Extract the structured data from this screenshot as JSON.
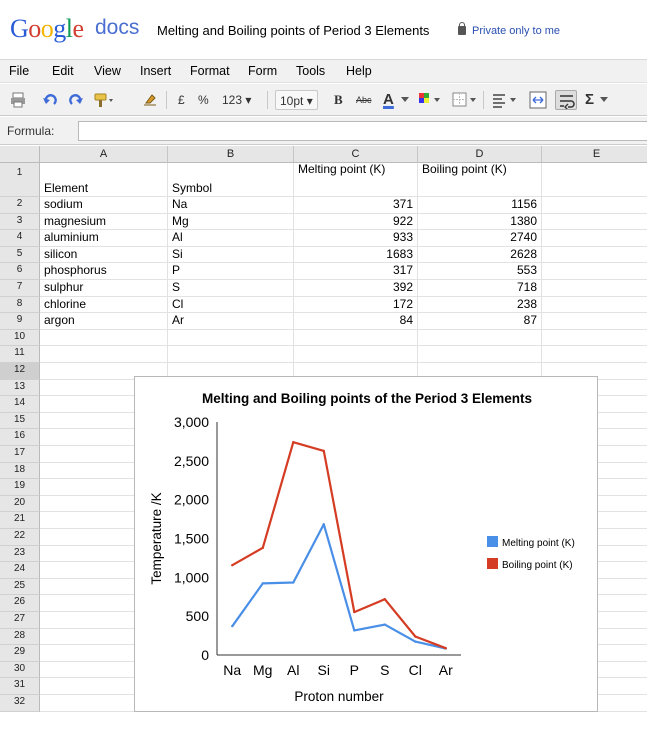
{
  "app": {
    "logo": "Google",
    "product": "docs",
    "doc_title": "Melting and Boiling points of Period 3 Elements",
    "privacy": "Private only to me"
  },
  "menu": [
    "File",
    "Edit",
    "View",
    "Insert",
    "Format",
    "Form",
    "Tools",
    "Help"
  ],
  "toolbar": {
    "currency": "£",
    "percent": "%",
    "number_format": "123 ▾",
    "font_size": "10pt ▾",
    "bold": "B",
    "strike": "Abc",
    "text_color": "A",
    "sum": "Σ"
  },
  "formula": {
    "label": "Formula:",
    "value": ""
  },
  "columns": [
    "A",
    "B",
    "C",
    "D",
    "E"
  ],
  "rows": [
    "1",
    "2",
    "3",
    "4",
    "5",
    "6",
    "7",
    "8",
    "9",
    "10",
    "11",
    "12",
    "13",
    "14",
    "15",
    "16",
    "17",
    "18",
    "19",
    "20",
    "21",
    "22",
    "23",
    "24",
    "25",
    "26",
    "27",
    "28",
    "29",
    "30",
    "31",
    "32"
  ],
  "selected_row": "12",
  "header_cells": [
    "Element",
    "Symbol",
    "Melting point (K)",
    "Boiling point (K)"
  ],
  "table": [
    [
      "sodium",
      "Na",
      "371",
      "1156"
    ],
    [
      "magnesium",
      "Mg",
      "922",
      "1380"
    ],
    [
      "aluminium",
      "Al",
      "933",
      "2740"
    ],
    [
      "silicon",
      "Si",
      "1683",
      "2628"
    ],
    [
      "phosphorus",
      "P",
      "317",
      "553"
    ],
    [
      "sulphur",
      "S",
      "392",
      "718"
    ],
    [
      "chlorine",
      "Cl",
      "172",
      "238"
    ],
    [
      "argon",
      "Ar",
      "84",
      "87"
    ]
  ],
  "chart_data": {
    "type": "line",
    "title": "Melting and Boiling points of the Period 3 Elements",
    "xlabel": "Proton number",
    "ylabel": "Temperature /K",
    "categories": [
      "Na",
      "Mg",
      "Al",
      "Si",
      "P",
      "S",
      "Cl",
      "Ar"
    ],
    "ylim": [
      0,
      3000
    ],
    "yticks": [
      "0",
      "500",
      "1,000",
      "1,500",
      "2,000",
      "2,500",
      "3,000"
    ],
    "legend_position": "right",
    "grid": false,
    "series": [
      {
        "name": "Melting point (K)",
        "color": "#4a8fe7",
        "values": [
          371,
          922,
          933,
          1683,
          317,
          392,
          172,
          84
        ]
      },
      {
        "name": "Boiling point (K)",
        "color": "#d43c23",
        "values": [
          1156,
          1380,
          2740,
          2628,
          553,
          718,
          238,
          87
        ]
      }
    ]
  }
}
